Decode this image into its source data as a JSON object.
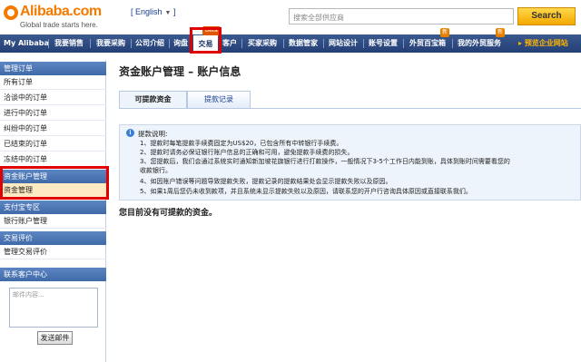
{
  "header": {
    "logo_name": "Alibaba.com",
    "logo_tagline": "Global trade starts here.",
    "language": "English",
    "search_placeholder": "搜索全部供应商",
    "search_button": "Search"
  },
  "nav": {
    "items": [
      "My Alibaba",
      "我要销售",
      "我要采购",
      "公司介绍",
      "询盘",
      "交易",
      "客户",
      "买家采购",
      "数据管家",
      "网站设计",
      "账号设置",
      "外贸百宝箱",
      "我的外贸服务"
    ],
    "cta": "预览企业网站",
    "beta_badge": "Beta",
    "new_badge_1": "新",
    "new_badge_2": "新"
  },
  "sidebar": {
    "sections": [
      {
        "title": "管理订单",
        "items": [
          "所有订单",
          "洽谈中的订单",
          "进行中的订单",
          "纠纷中的订单",
          "已结束的订单",
          "冻结中的订单"
        ]
      },
      {
        "title": "资金账户管理",
        "items": [
          "资金管理"
        ]
      },
      {
        "title": "支付宝专区",
        "items": [
          "银行账户管理"
        ]
      },
      {
        "title": "交易评价",
        "items": [
          "管理交易评价"
        ]
      },
      {
        "title": "联系客户中心",
        "items": []
      }
    ],
    "contact_placeholder": "邮件内容...",
    "send_button": "发送邮件"
  },
  "main": {
    "title": "资金账户管理 – 账户信息",
    "tabs": [
      "可提款资金",
      "提款记录"
    ],
    "notice": {
      "title": "提款说明:",
      "lines": [
        "1、提款时每笔提款手续费固定为US$20，已包含所有中转银行手续费。",
        "2、提款时请务必保证银行账户信息的正确和可用，避免提款手续费的损失。",
        "3、您提款后，我们会通过系统实时通知新加坡花旗银行进行打款操作，一般情况下3-5个工作日内能到账，具体到账时间需要看您的",
        "收款银行。",
        "4、如因账户错误等问题导致提款失败，提款记录的提款结果处会显示提款失败以及原因。",
        "5、如果1周后您仍未收到款项，并且系统未显示提款失败以及原因，请联系您的开户行咨询具体原因或直接联系我们。"
      ]
    },
    "empty_message": "您目前没有可提款的资金。"
  }
}
